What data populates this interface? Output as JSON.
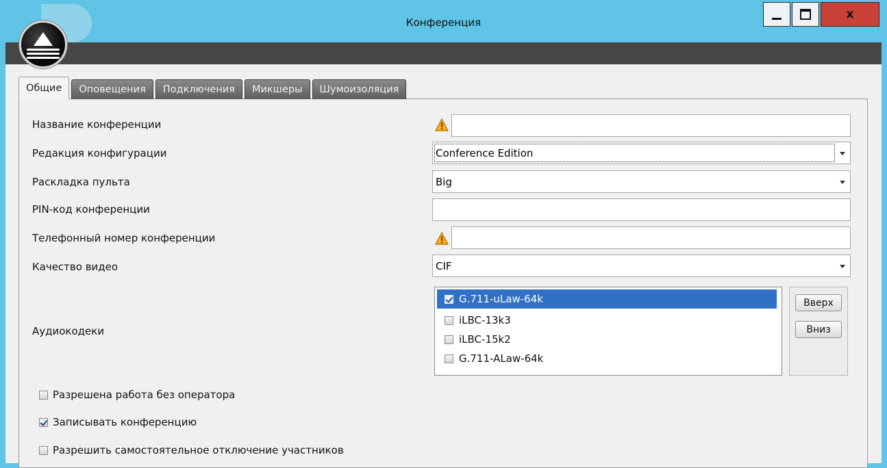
{
  "window": {
    "title": "Конференция",
    "close_glyph": "x"
  },
  "tabs": [
    {
      "label": "Общие",
      "active": true
    },
    {
      "label": "Оповещения",
      "active": false
    },
    {
      "label": "Подключения",
      "active": false
    },
    {
      "label": "Микшеры",
      "active": false
    },
    {
      "label": "Шумоизоляция",
      "active": false
    }
  ],
  "form": {
    "conference_name": {
      "label": "Название конференции",
      "value": "",
      "warning": true
    },
    "config_edition": {
      "label": "Редакция конфигурации",
      "value": "Conference Edition"
    },
    "console_layout": {
      "label": "Раскладка пульта",
      "value": "Big"
    },
    "pin": {
      "label": "PIN-код конференции",
      "value": ""
    },
    "phone": {
      "label": "Телефонный номер конференции",
      "value": "",
      "warning": true
    },
    "video_quality": {
      "label": "Качество видео",
      "value": "CIF"
    },
    "audio_codecs": {
      "label": "Аудиокодеки",
      "items": [
        {
          "name": "G.711-uLaw-64k",
          "checked": true,
          "selected": true
        },
        {
          "name": "iLBC-13k3",
          "checked": false,
          "selected": false
        },
        {
          "name": "iLBC-15k2",
          "checked": false,
          "selected": false
        },
        {
          "name": "G.711-ALaw-64k",
          "checked": false,
          "selected": false
        }
      ],
      "up_label": "Вверх",
      "down_label": "Вниз"
    }
  },
  "options": [
    {
      "label": "Разрешена работа без оператора",
      "checked": false
    },
    {
      "label": "Записывать конференцию",
      "checked": true
    },
    {
      "label": "Разрешить самостоятельное отключение участников",
      "checked": false
    }
  ],
  "colors": {
    "titlebar": "#5fc4e6",
    "selection": "#3071c6",
    "close_button": "#c84036",
    "warning": "#f2b416"
  },
  "icons": [
    "app-logo-icon",
    "minimize-icon",
    "maximize-icon",
    "close-icon",
    "warning-icon",
    "dropdown-arrow-icon",
    "checkbox-icon"
  ]
}
